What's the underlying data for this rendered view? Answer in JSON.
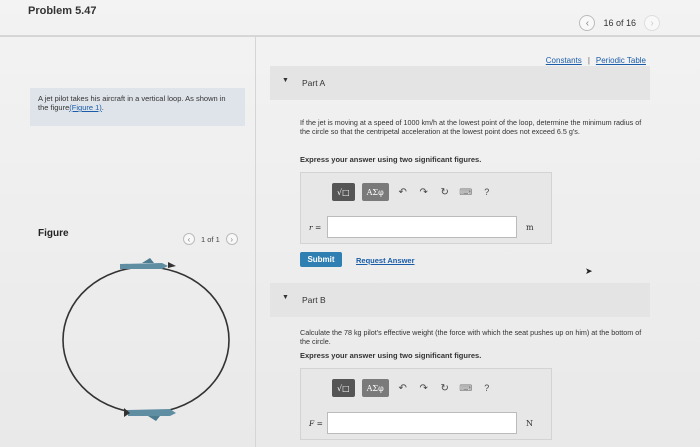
{
  "header": {
    "title": "Problem 5.47",
    "page_count": "16 of 16"
  },
  "links": {
    "constants": "Constants",
    "separator": "|",
    "periodic_table": "Periodic Table"
  },
  "intro": {
    "text": "A jet pilot takes his aircraft in a vertical loop. As shown in the figure",
    "figure_link": "(Figure 1)",
    "tail": "."
  },
  "figure": {
    "label": "Figure",
    "pager": "1 of 1"
  },
  "part_a": {
    "title": "Part A",
    "question": "If the jet is moving at a speed of 1000 km/h at the lowest point of the loop, determine the minimum radius of the circle so that the centripetal acceleration at the lowest point does not exceed 6.5 g's.",
    "instruction": "Express your answer using two significant figures.",
    "variable": "r =",
    "unit": "m",
    "submit_label": "Submit",
    "request_label": "Request Answer"
  },
  "part_b": {
    "title": "Part B",
    "question": "Calculate the 78 kg pilot's effective weight (the force with which the seat pushes up on him) at the bottom of the circle.",
    "instruction": "Express your answer using two significant figures.",
    "variable": "F =",
    "unit": "N"
  },
  "toolbar": {
    "templates": "√□",
    "greek": "ΑΣφ"
  },
  "colors": {
    "link": "#1a5ca8",
    "submit": "#2f7fb3",
    "intro_bg": "#dfe4ea"
  }
}
